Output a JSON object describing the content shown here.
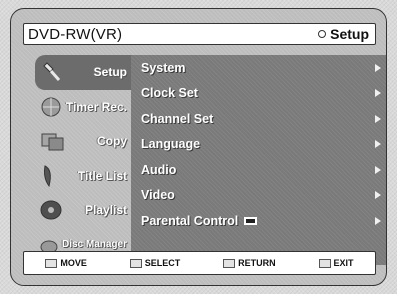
{
  "title_bar": {
    "mode": "DVD-RW(VR)",
    "section": "Setup"
  },
  "sidebar": {
    "items": [
      {
        "label": "Setup",
        "icon": "wrench-icon",
        "active": true
      },
      {
        "label": "Timer Rec.",
        "icon": "globe-icon",
        "active": false
      },
      {
        "label": "Copy",
        "icon": "copy-icon",
        "active": false
      },
      {
        "label": "Title List",
        "icon": "list-icon",
        "active": false
      },
      {
        "label": "Playlist",
        "icon": "disc-icon",
        "active": false
      },
      {
        "label": "Disc Manager",
        "icon": "disc-manager-icon",
        "active": false
      }
    ]
  },
  "menu": {
    "items": [
      {
        "label": "System"
      },
      {
        "label": "Clock Set"
      },
      {
        "label": "Channel Set"
      },
      {
        "label": "Language"
      },
      {
        "label": "Audio"
      },
      {
        "label": "Video"
      },
      {
        "label": "Parental Control"
      }
    ]
  },
  "footer": {
    "move": "MOVE",
    "select": "SELECT",
    "return": "RETURN",
    "exit": "EXIT"
  }
}
